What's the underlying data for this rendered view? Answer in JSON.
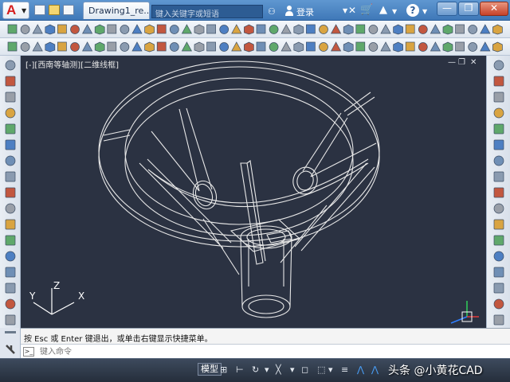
{
  "titlebar": {
    "app_menu_letter": "A",
    "document_tab": "Drawing1_re...",
    "search_placeholder": "键入关键字或短语",
    "login_label": "登录",
    "help_label": "?"
  },
  "window_controls": {
    "minimize": "—",
    "restore": "❐",
    "close": "✕"
  },
  "viewport": {
    "label": "[-][西南等轴测][二维线框]",
    "minimize": "—",
    "restore": "❐",
    "close": "✕"
  },
  "ucs": {
    "x_label": "X",
    "y_label": "Y",
    "z_label": "Z"
  },
  "command": {
    "history": "按 Esc 或 Enter 键退出，或单击右键显示快捷菜单。",
    "input_placeholder": "键入命令",
    "prompt_icon": ">_"
  },
  "statusbar": {
    "model_tab": "模型"
  },
  "watermark": "头条 @小黄花CAD",
  "colors": {
    "titlebar": "#4f88c6",
    "canvas": "#2b3242",
    "statusbar": "#2f3846",
    "close": "#c6412a"
  }
}
